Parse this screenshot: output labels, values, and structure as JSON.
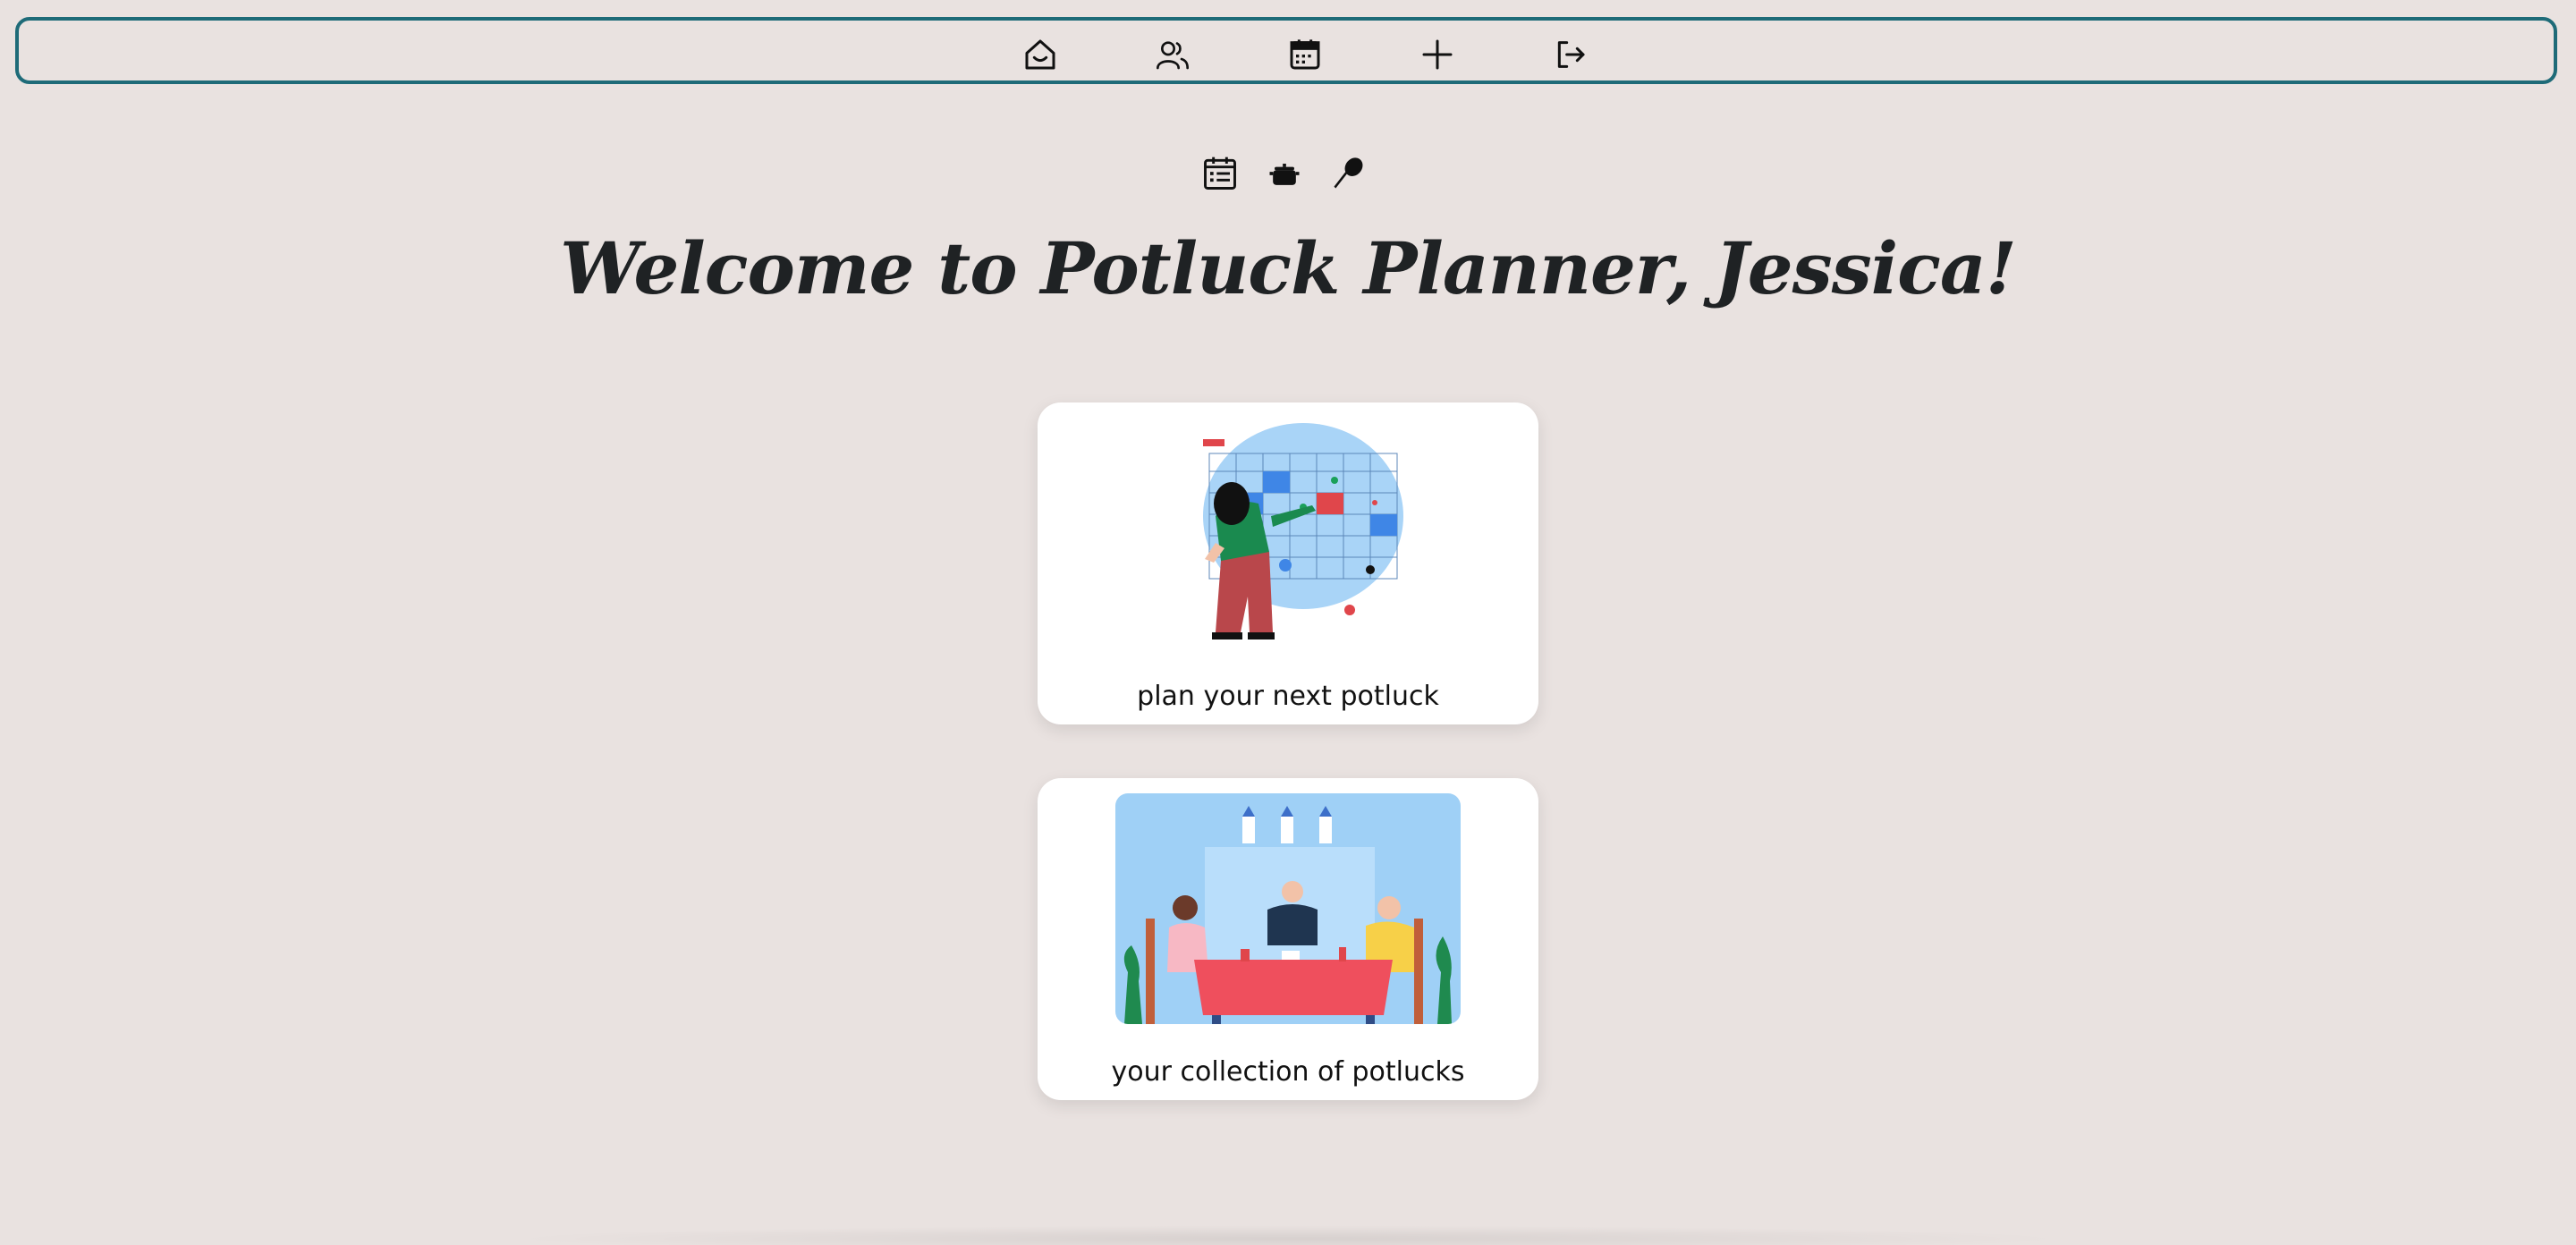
{
  "nav": {
    "items": [
      {
        "icon": "home-icon"
      },
      {
        "icon": "users-icon"
      },
      {
        "icon": "calendar-icon"
      },
      {
        "icon": "plus-icon"
      },
      {
        "icon": "logout-icon"
      }
    ]
  },
  "icon_row": [
    "calendar-list-icon",
    "pot-icon",
    "spoon-icon"
  ],
  "welcome": {
    "title": "Welcome to Potluck Planner, Jessica!"
  },
  "cards": [
    {
      "label": "plan your next potluck",
      "image": "calendar-planning-illustration"
    },
    {
      "label": "your collection of potlucks",
      "image": "friends-dining-illustration"
    }
  ],
  "colors": {
    "background": "#e9e2e0",
    "nav_border": "#1e6b78",
    "card": "#ffffff"
  }
}
